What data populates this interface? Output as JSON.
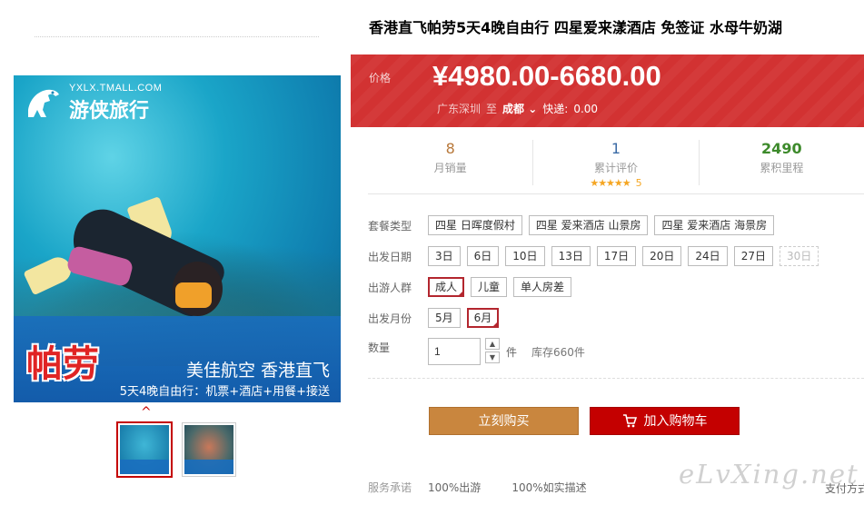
{
  "product": {
    "title": "香港直飞帕劳5天4晚自由行 四星爱来漾酒店 免签证 水母牛奶湖"
  },
  "image": {
    "logo_url": "YXLX.TMALL.COM",
    "logo_name": "游侠旅行",
    "place": "帕劳",
    "banner_line1": "美佳航空 香港直飞",
    "banner_line2": "5天4晚自由行：机票+酒店+用餐+接送",
    "thumbs": [
      "thumb-1",
      "thumb-2"
    ]
  },
  "price": {
    "label": "价格",
    "value": "¥4980.00-6680.00",
    "origin": "广东深圳",
    "to": "至",
    "city": "成都",
    "fee_label": "快递:",
    "fee": "0.00"
  },
  "stats": {
    "monthly_sales_num": "8",
    "monthly_sales_label": "月销量",
    "reviews_num": "1",
    "reviews_label": "累计评价",
    "stars": "★★★★★",
    "score": "5",
    "mileage_num": "2490",
    "mileage_label": "累积里程"
  },
  "options": {
    "package_label": "套餐类型",
    "packages": [
      "四星 日晖度假村",
      "四星 爱来酒店 山景房",
      "四星 爱来酒店 海景房"
    ],
    "date_label": "出发日期",
    "dates": [
      "3日",
      "6日",
      "10日",
      "13日",
      "17日",
      "20日",
      "24日",
      "27日",
      "30日"
    ],
    "crowd_label": "出游人群",
    "crowds": [
      "成人",
      "儿童",
      "单人房差"
    ],
    "month_label": "出发月份",
    "months": [
      "5月",
      "6月"
    ],
    "qty_label": "数量",
    "qty_value": "1",
    "qty_unit": "件",
    "stock": "库存660件"
  },
  "actions": {
    "buy_now": "立刻购买",
    "add_cart": "加入购物车"
  },
  "service": {
    "label": "服务承诺",
    "items": [
      "100%出游",
      "100%如实描述"
    ],
    "pay": "支付方式"
  },
  "watermark": "eLvXing.net",
  "colors": {
    "price_bg": "#d23232",
    "buy_btn": "#c9863e",
    "cart_btn": "#c40000",
    "selected_border": "#b3262e"
  }
}
